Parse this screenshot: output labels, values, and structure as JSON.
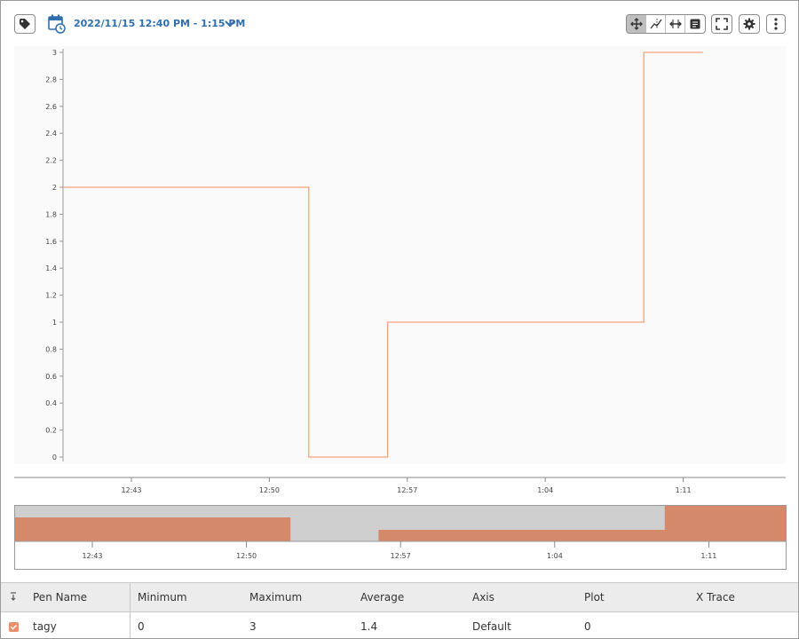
{
  "toolbar": {
    "date_range": "2022/11/15 12:40 PM - 1:15 PM",
    "icons": {
      "tag": "tag-icon",
      "calendar": "calendar-clock-icon",
      "dropdown": "chevron-down-icon",
      "pan": "pan-icon",
      "x_trace": "x-trace-icon",
      "range_select": "range-select-icon",
      "annotation": "annotation-icon",
      "fullscreen": "fullscreen-icon",
      "settings": "gear-icon",
      "more": "more-vertical-icon"
    },
    "active_mode": "pan"
  },
  "chart_data": {
    "type": "line",
    "step": true,
    "title": "",
    "xlabel": "",
    "ylabel": "",
    "ylim": [
      0,
      3
    ],
    "y_ticks": [
      "0",
      "0.2",
      "0.4",
      "0.6",
      "0.8",
      "1",
      "1.2",
      "1.4",
      "1.6",
      "1.8",
      "2",
      "2.2",
      "2.4",
      "2.6",
      "2.8",
      "3"
    ],
    "x_ticks": [
      "12:43",
      "12:50",
      "12:57",
      "1:04",
      "1:11"
    ],
    "series": [
      {
        "name": "tagy",
        "color": "#f4a27e",
        "x": [
          "12:40",
          "12:52",
          "12:52",
          "12:56",
          "12:56",
          "1:09",
          "1:09",
          "1:12"
        ],
        "y": [
          2,
          2,
          0,
          0,
          1,
          1,
          3,
          3
        ]
      }
    ],
    "grid": false
  },
  "navigator": {
    "x_ticks": [
      "12:43",
      "12:50",
      "12:57",
      "1:04",
      "1:11"
    ],
    "fill_color": "#d5896b",
    "selection_color": "#cfcfcf"
  },
  "pen_table": {
    "headers": [
      "Pen Name",
      "Minimum",
      "Maximum",
      "Average",
      "Axis",
      "Plot",
      "X Trace"
    ],
    "rows": [
      {
        "checked": true,
        "pen_name": "tagy",
        "minimum": "0",
        "maximum": "3",
        "average": "1.4",
        "axis": "Default",
        "plot": "0",
        "x_trace": ""
      }
    ]
  }
}
